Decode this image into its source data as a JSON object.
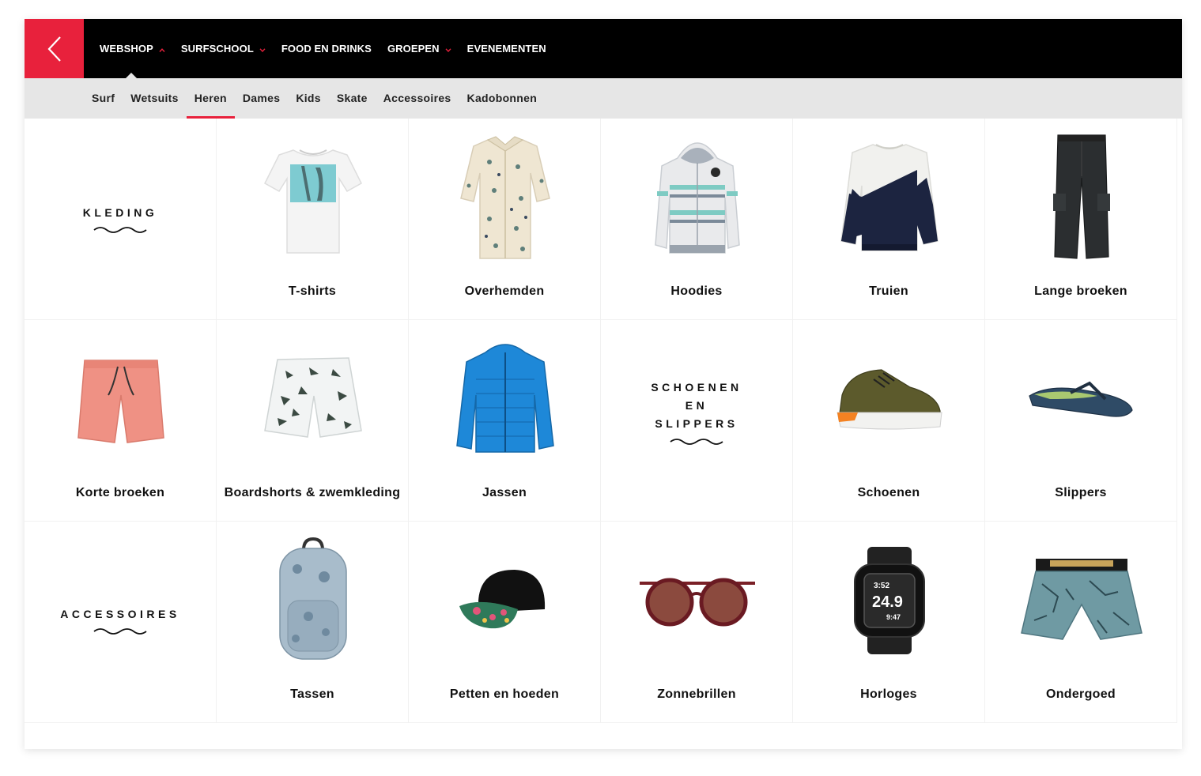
{
  "nav": {
    "back_icon": "chevron-left-icon",
    "items": [
      {
        "label": "WEBSHOP",
        "has_caret": true
      },
      {
        "label": "SURFSCHOOL",
        "has_caret": true
      },
      {
        "label": "FOOD EN DRINKS",
        "has_caret": false
      },
      {
        "label": "GROEPEN",
        "has_caret": true
      },
      {
        "label": "EVENEMENTEN",
        "has_caret": false
      }
    ],
    "active_item": "WEBSHOP"
  },
  "subnav": {
    "items": [
      "Surf",
      "Wetsuits",
      "Heren",
      "Dames",
      "Kids",
      "Skate",
      "Accessoires",
      "Kadobonnen"
    ],
    "active_item": "Heren"
  },
  "categories": {
    "kleding_heading": "KLEDING",
    "schoenen_heading_lines": [
      "SCHOENEN",
      "EN",
      "SLIPPERS"
    ],
    "accessoires_heading": "ACCESSOIRES",
    "tshirts": "T-shirts",
    "overhemden": "Overhemden",
    "hoodies": "Hoodies",
    "truien": "Truien",
    "lange_broeken": "Lange broeken",
    "korte_broeken": "Korte broeken",
    "boardshorts": "Boardshorts & zwemkleding",
    "jassen": "Jassen",
    "schoenen": "Schoenen",
    "slippers": "Slippers",
    "tassen": "Tassen",
    "petten": "Petten en hoeden",
    "zonnebrillen": "Zonnebrillen",
    "horloges": "Horloges",
    "ondergoed": "Ondergoed"
  },
  "watch_display": {
    "time": "3:52",
    "value": "24.9",
    "sub": "9:47"
  },
  "colors": {
    "accent": "#e8213c",
    "topbar": "#000000",
    "subbar": "#e6e6e6"
  }
}
